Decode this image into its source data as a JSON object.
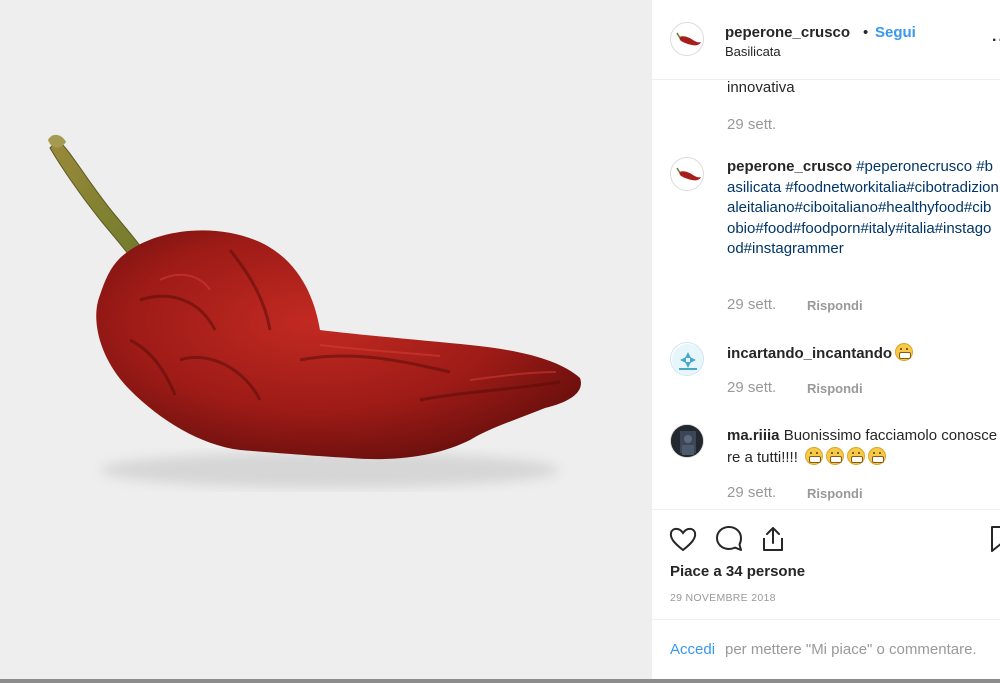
{
  "post": {
    "username": "peperone_crusco",
    "separator": "•",
    "follow_label": "Segui",
    "location": "Basilicata",
    "more_label": "..."
  },
  "comments": [
    {
      "text": "innovativa",
      "date": "29 sett."
    },
    {
      "user": "peperone_crusco",
      "tags": [
        "#peperonecrusco",
        "#basilicata",
        "#foodnetworkitalia#cibotradizionaleitaliano#ciboitaliano#healthyfood#cibobio#food#foodporn#italy#italia#instagood#instagrammer"
      ],
      "date": "29 sett.",
      "reply_label": "Rispondi"
    },
    {
      "user": "incartando_incantando",
      "text": "",
      "date": "29 sett.",
      "reply_label": "Rispondi"
    },
    {
      "user": "ma.riiia",
      "text": "Buonissimo facciamolo conoscere a tutti!!!!",
      "date": "29 sett.",
      "reply_label": "Rispondi"
    }
  ],
  "actions": {
    "likes_text": "Piace a 34 persone",
    "date_text": "29 NOVEMBRE 2018"
  },
  "login": {
    "link_label": "Accedi",
    "rest_text": "per mettere \"Mi piace\" o commentare."
  },
  "icons": {
    "like": "heart-icon",
    "comment": "comment-icon",
    "share": "share-icon",
    "save": "bookmark-icon"
  },
  "colors": {
    "link_blue": "#3897f0",
    "hashtag_navy": "#003569",
    "muted_gray": "#999999",
    "pepper_red": "#a81e1a"
  }
}
